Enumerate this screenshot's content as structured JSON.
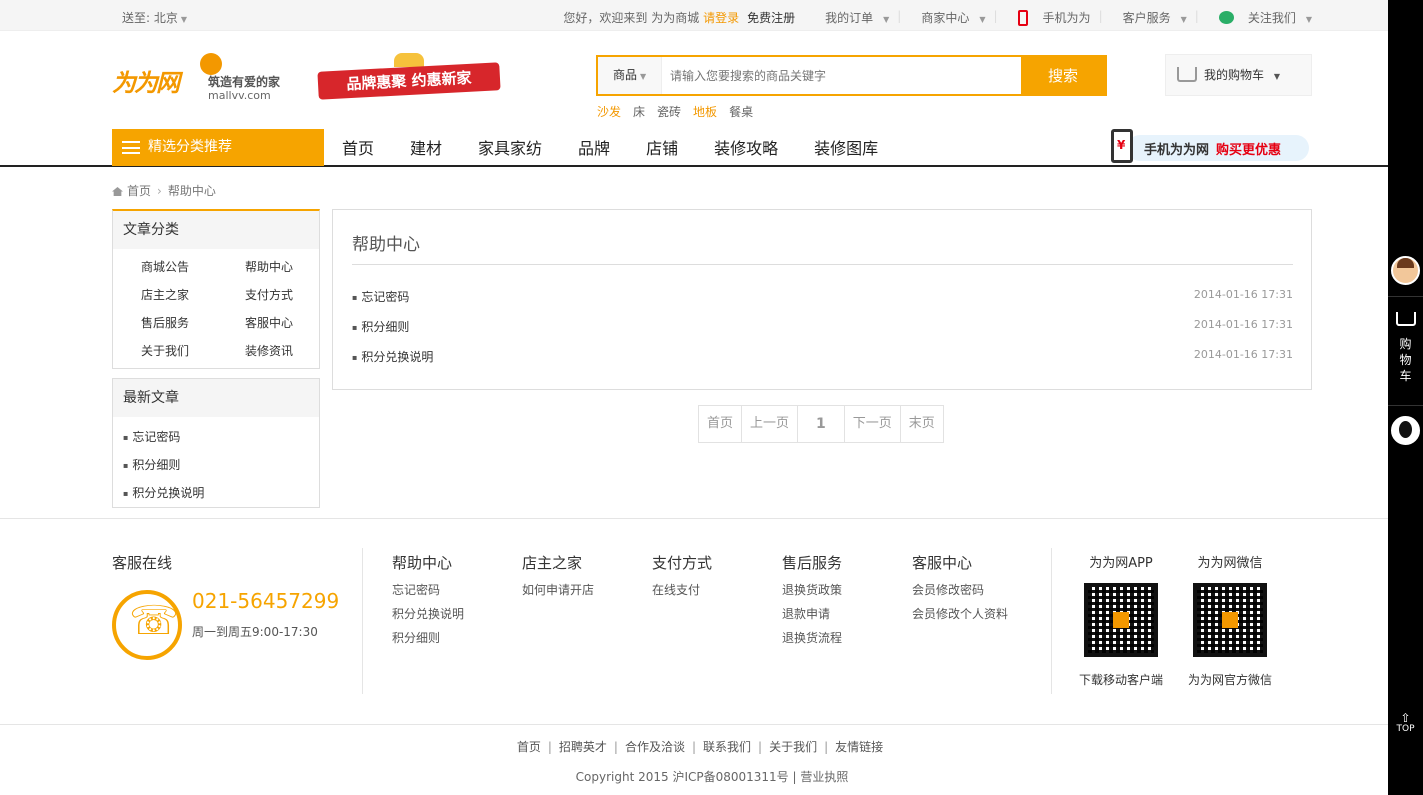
{
  "topbar": {
    "deliver_label": "送至: 北京",
    "welcome": "您好，欢迎来到 为为商城",
    "login": "请登录",
    "register": "免费注册",
    "my_orders": "我的订单",
    "merchant_center": "商家中心",
    "mobile": "手机为为",
    "customer_service": "客户服务",
    "follow_us": "关注我们"
  },
  "logo": {
    "mark": "为为网",
    "slogan": "筑造有爱的家",
    "url": "mallvv.com"
  },
  "banner": {
    "text": "品牌惠聚 约惠新家"
  },
  "search": {
    "category": "商品",
    "placeholder": "请输入您要搜索的商品关键字",
    "button": "搜索",
    "hotwords": [
      {
        "text": "沙发",
        "highlight": true
      },
      {
        "text": "床",
        "highlight": false
      },
      {
        "text": "瓷砖",
        "highlight": false
      },
      {
        "text": "地板",
        "highlight": true
      },
      {
        "text": "餐桌",
        "highlight": false
      }
    ]
  },
  "cart": {
    "label": "我的购物车"
  },
  "nav": {
    "category_button": "精选分类推荐",
    "links": [
      "首页",
      "建材",
      "家具家纺",
      "品牌",
      "店铺",
      "装修攻略",
      "装修图库"
    ],
    "promo_title": "手机为为网",
    "promo_highlight": "购买更优惠"
  },
  "breadcrumb": {
    "home": "首页",
    "current": "帮助中心"
  },
  "sidebar": {
    "categories_title": "文章分类",
    "categories": [
      "商城公告",
      "帮助中心",
      "店主之家",
      "支付方式",
      "售后服务",
      "客服中心",
      "关于我们",
      "装修资讯"
    ],
    "latest_title": "最新文章",
    "latest": [
      "忘记密码",
      "积分细则",
      "积分兑换说明"
    ]
  },
  "main": {
    "title": "帮助中心",
    "articles": [
      {
        "title": "忘记密码",
        "date": "2014-01-16 17:31"
      },
      {
        "title": "积分细则",
        "date": "2014-01-16 17:31"
      },
      {
        "title": "积分兑换说明",
        "date": "2014-01-16 17:31"
      }
    ]
  },
  "pager": {
    "first": "首页",
    "prev": "上一页",
    "current": "1",
    "next": "下一页",
    "last": "末页"
  },
  "footer": {
    "service_title": "客服在线",
    "hotline": "021-56457299",
    "hours": "周一到周五9:00-17:30",
    "columns": [
      {
        "title": "帮助中心",
        "items": [
          "忘记密码",
          "积分兑换说明",
          "积分细则"
        ]
      },
      {
        "title": "店主之家",
        "items": [
          "如何申请开店"
        ]
      },
      {
        "title": "支付方式",
        "items": [
          "在线支付"
        ]
      },
      {
        "title": "售后服务",
        "items": [
          "退换货政策",
          "退款申请",
          "退换货流程"
        ]
      },
      {
        "title": "客服中心",
        "items": [
          "会员修改密码",
          "会员修改个人资料"
        ]
      }
    ],
    "app": {
      "title": "为为网APP",
      "caption": "下载移动客户端"
    },
    "wechat": {
      "title": "为为网微信",
      "caption": "为为网官方微信"
    },
    "links": [
      "首页",
      "招聘英才",
      "合作及洽谈",
      "联系我们",
      "关于我们",
      "友情链接"
    ],
    "copyright": "Copyright 2015 沪ICP备08001311号 | 营业执照"
  },
  "rightbar": {
    "cart": [
      "购",
      "物",
      "车"
    ],
    "top": "TOP"
  },
  "colors": {
    "accent": "#f6a400",
    "link_highlight": "#f39800",
    "promo_red": "#e60012"
  }
}
